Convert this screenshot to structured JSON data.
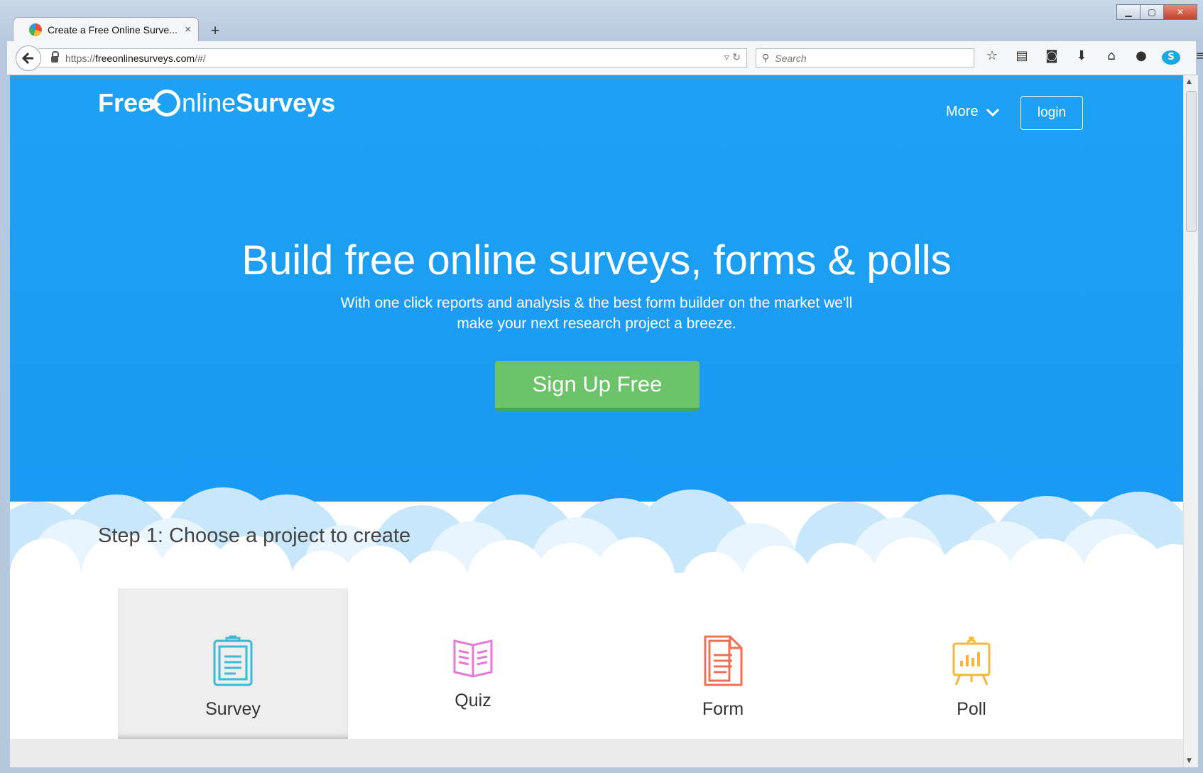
{
  "browser": {
    "tab_title": "Create a Free Online Surve...",
    "tab_close": "×",
    "new_tab": "+",
    "url_scheme": "https://",
    "url_host": "freeonlinesurveys.com",
    "url_path": "/#/",
    "search_placeholder": "Search"
  },
  "site": {
    "logo_free": "Free",
    "logo_nline": "nline",
    "logo_surveys": "Surveys",
    "nav_more": "More",
    "nav_login": "login"
  },
  "hero": {
    "title": "Build free online surveys, forms & polls",
    "subtitle": "With one click reports and analysis & the best form builder on the market we'll make your next research project a breeze.",
    "cta": "Sign Up Free",
    "accent_color": "#1ea1f4",
    "cta_color": "#6cc36a"
  },
  "step": {
    "title": "Step 1: Choose a project to create",
    "projects": [
      {
        "label": "Survey",
        "icon": "clipboard-icon",
        "color": "#3fb8d6",
        "selected": true
      },
      {
        "label": "Quiz",
        "icon": "book-icon",
        "color": "#e47ad6",
        "selected": false
      },
      {
        "label": "Form",
        "icon": "document-icon",
        "color": "#ee7152",
        "selected": false
      },
      {
        "label": "Poll",
        "icon": "easel-chart-icon",
        "color": "#f5b73a",
        "selected": false
      }
    ]
  }
}
